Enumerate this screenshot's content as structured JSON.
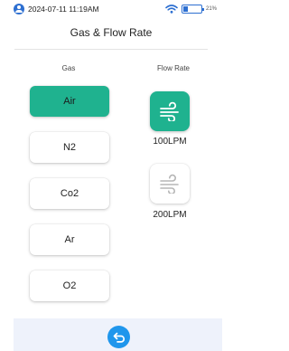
{
  "status": {
    "datetime": "2024-07-11 11:19AM",
    "battery_percent": "21%",
    "user_icon": "user-icon",
    "wifi_icon": "wifi-icon",
    "battery_icon": "battery-icon"
  },
  "title": "Gas & Flow Rate",
  "columns": {
    "gas": "Gas",
    "flow_rate": "Flow Rate"
  },
  "gas_options": [
    {
      "label": "Air",
      "selected": true
    },
    {
      "label": "N2",
      "selected": false
    },
    {
      "label": "Co2",
      "selected": false
    },
    {
      "label": "Ar",
      "selected": false
    },
    {
      "label": "O2",
      "selected": false
    }
  ],
  "flow_options": [
    {
      "label": "100LPM",
      "selected": true,
      "icon": "wind-icon"
    },
    {
      "label": "200LPM",
      "selected": false,
      "icon": "wind-icon"
    }
  ],
  "footer": {
    "back_icon": "back-arrow-icon"
  },
  "colors": {
    "accent": "#1fb28f",
    "back_button": "#1f96ec",
    "status_blue": "#2d6fd1",
    "footer_bg": "#eef2fb"
  }
}
